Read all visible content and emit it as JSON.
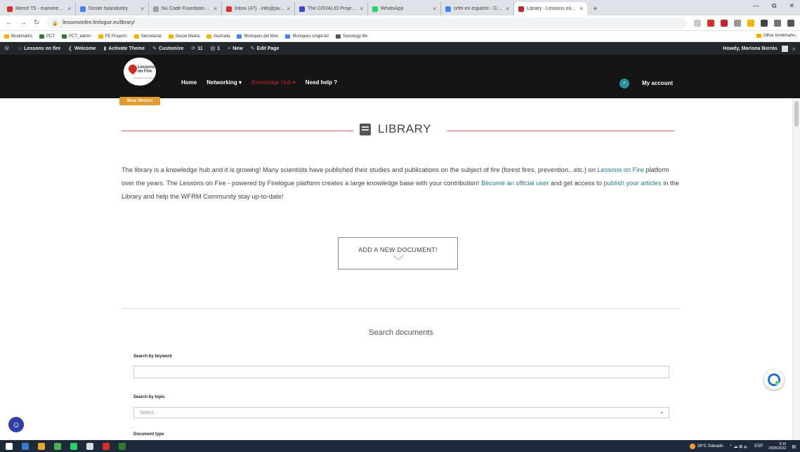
{
  "browser": {
    "tabs": [
      {
        "label": "Mercè T5 - mamoreBene",
        "color": "#d93025"
      },
      {
        "label": "Dosier bioindustry",
        "color": "#4285f4"
      },
      {
        "label": "Nu Code Foundation · Cl",
        "color": "#9aa0a6"
      },
      {
        "label": "Inbox (47) · info@paeuro",
        "color": "#d93025"
      },
      {
        "label": "The COVALID Project Nu",
        "color": "#3c4bc9"
      },
      {
        "label": "WhatsApp",
        "color": "#25d366"
      },
      {
        "label": "orfel en español - Googl",
        "color": "#4285f4"
      },
      {
        "label": "Library - Lessons on Fire",
        "color": "#c0262d"
      }
    ],
    "new_tab": "+",
    "window_controls": [
      "—",
      "⧉",
      "✕"
    ],
    "url": "lessonsonfire.firelogue.eu/library/",
    "extensions": [
      "#c9c9c9",
      "#d93025",
      "#c0262d",
      "#999999",
      "#f4b400",
      "#444444",
      "#777777",
      "#555555"
    ],
    "bookmarks": [
      {
        "label": "Bookmarks",
        "color": "#f4b400"
      },
      {
        "label": "PCT",
        "color": "#2e7d32"
      },
      {
        "label": "PCT_admin",
        "color": "#2e7d32"
      },
      {
        "label": "FE Projects",
        "color": "#f4b400"
      },
      {
        "label": "Secretariat",
        "color": "#f4b400"
      },
      {
        "label": "Social Media",
        "color": "#f4b400"
      },
      {
        "label": "Australia",
        "color": "#f4b400"
      },
      {
        "label": "Moniques del Mon",
        "color": "#4285f4"
      },
      {
        "label": "Moniques single-lel",
        "color": "#4285f4"
      },
      {
        "label": "Sociology lite",
        "color": "#555555"
      }
    ],
    "other_bookmarks": "Other bookmarks"
  },
  "wpbar": {
    "items": [
      {
        "icon": "⌂",
        "label": "Lessons on fire"
      },
      {
        "icon": "❮",
        "label": "Welcome"
      },
      {
        "icon": "▮",
        "label": "Activate Theme"
      },
      {
        "icon": "✎",
        "label": "Customize"
      },
      {
        "icon": "⟳",
        "label": "11"
      },
      {
        "icon": "▤",
        "label": "1"
      },
      {
        "icon": "+",
        "label": "New"
      },
      {
        "icon": "✎",
        "label": "Edit Page"
      }
    ],
    "howdy": "Howdy, Mariona Borràs",
    "search_glyph": "⌕"
  },
  "site": {
    "logo_text": "Lessons on Fire",
    "logo_sub": "Powered by Firelogue",
    "beta": "Beta Version",
    "nav": [
      "Home",
      "Networking ▾",
      "Knowledge Hub ▾",
      "Need help ?"
    ],
    "nav_active_index": 2,
    "search_glyph": "⌕",
    "my_account": "My account"
  },
  "library": {
    "title": "LIBRARY",
    "intro_parts": [
      "The library is a knowledge hub and it is growing! Many scientists have published their studies and publications on the subject of fire (forest fires, prevention...etc.) on ",
      "Lessons on Fire",
      " platform over the years. The Lessons on Fire - powered by Firelogue platform creates a large knowledge base with your contribution! ",
      "Become an official user",
      " and get access to ",
      "publish your articles",
      " in the Library and help the WFRM Community stay up-to-date!"
    ],
    "add_button": "ADD A NEW DOCUMENT!",
    "search_title": "Search documents",
    "keyword_label": "Search by keyword",
    "keyword_placeholder": "",
    "topic_label": "Search by topic",
    "topic_value": "Select",
    "doctype_label": "Document type"
  },
  "taskbar": {
    "icons": [
      "#ffffff",
      "#3a7bd5",
      "#e8a92c",
      "#4caf50",
      "#25d366",
      "#dddddd",
      "#d93025",
      "#2e7d32"
    ],
    "weather": "28°C Soleado",
    "lang": "ESP",
    "time": "9:16",
    "date": "26/05/2022"
  },
  "colors": {
    "accent_red": "#c0262d",
    "link_teal": "#2b7c8f",
    "header_bg": "#141414"
  }
}
